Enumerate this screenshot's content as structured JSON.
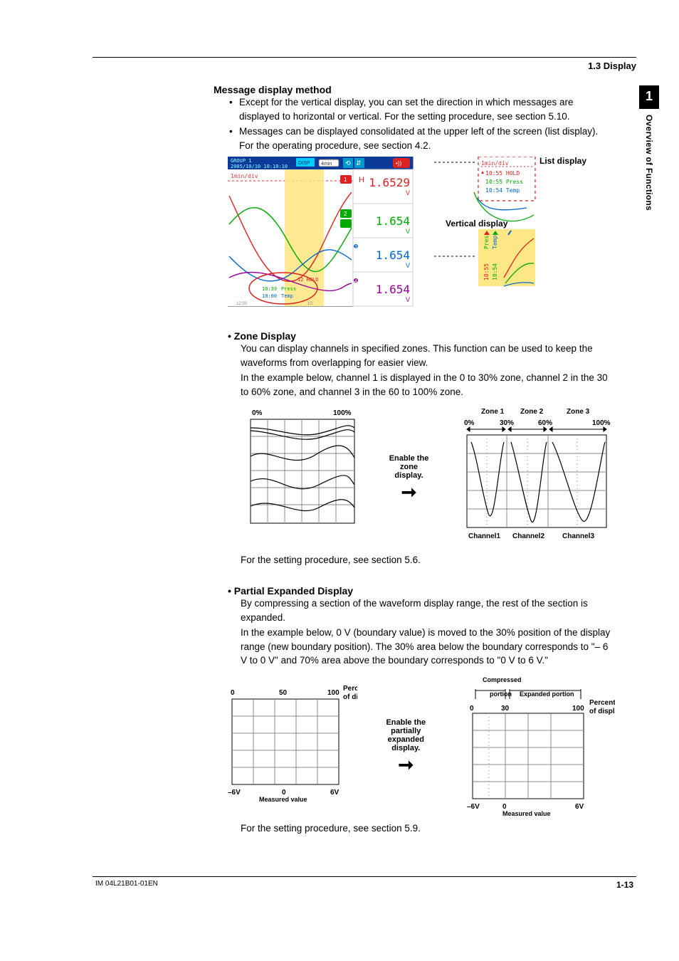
{
  "header": {
    "section": "1.3  Display"
  },
  "side": {
    "num": "1",
    "label": "Overview of Functions"
  },
  "msg": {
    "title": "Message display method",
    "b1": "Except for the vertical display, you can set the direction in which messages are displayed to horizontal or vertical. For the setting procedure, see section 5.10.",
    "b2": "Messages can be displayed consolidated at the upper left of the screen (list display). For the operating procedure, see section 4.2.",
    "list_label": "List display",
    "vert_label": "Vertical display",
    "screenshot": {
      "group": "GROUP 1",
      "datetime": "2005/10/10 10:10:10",
      "disp": "DISP",
      "rate": "4min",
      "scale": "1min/div",
      "val1": "1.6529",
      "val2": "1.654",
      "val3": "1.654",
      "val4": "1.654",
      "unit": "V",
      "hold": "12 HOLD",
      "t1": "10:39",
      "t2": "10:00",
      "m1": "Press",
      "m2": "Temp",
      "list_scale": "1min/div",
      "list_1": "10:55 HOLD",
      "list_2": "10:55 Press",
      "list_3": "10:54 Temp",
      "vtime1": "10:55",
      "vtime2": "10:54",
      "vmsg1": "Press",
      "vmsg2": "Temp"
    }
  },
  "zone": {
    "title": "Zone Display",
    "p1": "You can display channels in specified zones. This function can be used to keep the waveforms from overlapping for easier view.",
    "p2": "In the example below, channel 1 is displayed in the 0 to 30% zone, channel 2 in the 30 to 60% zone, and channel 3 in the 60 to 100% zone.",
    "midL1": "Enable the",
    "midL2": "zone display.",
    "left_0": "0%",
    "left_100": "100%",
    "z1": "Zone 1",
    "z2": "Zone 2",
    "z3": "Zone 3",
    "r0": "0%",
    "r30": "30%",
    "r60": "60%",
    "r100": "100%",
    "ch1": "Channel1",
    "ch2": "Channel2",
    "ch3": "Channel3",
    "after": "For the setting procedure, see section 5.6."
  },
  "partial": {
    "title": "Partial Expanded Display",
    "p1": "By compressing a section of the waveform display range, the rest of the section is expanded.",
    "p2": "In the example below, 0 V (boundary value) is moved to the 30% position of the display range (new boundary position). The 30% area below the boundary corresponds to \"– 6 V to 0 V\" and 70% area above the boundary corresponds to \"0 V to 6 V.\"",
    "midL1": "Enable the partially",
    "midL2": "expanded display.",
    "left": {
      "t0": "0",
      "t50": "50",
      "t100": "100",
      "bL": "–6V",
      "b0": "0",
      "bR": "6V",
      "ml": "Measured value",
      "pl1": "Percentage",
      "pl2": "of display span"
    },
    "right": {
      "t0": "0",
      "t30": "30",
      "t100": "100",
      "bL": "–6V",
      "b0": "0",
      "bR": "6V",
      "ml": "Measured value",
      "pl1": "Percentage",
      "pl2": "of display span",
      "comp": "Compressed",
      "port": "portion",
      "exp": "Expanded portion"
    },
    "after": "For the setting procedure, see section 5.9."
  },
  "footer": {
    "left": "IM 04L21B01-01EN",
    "right": "1-13"
  }
}
